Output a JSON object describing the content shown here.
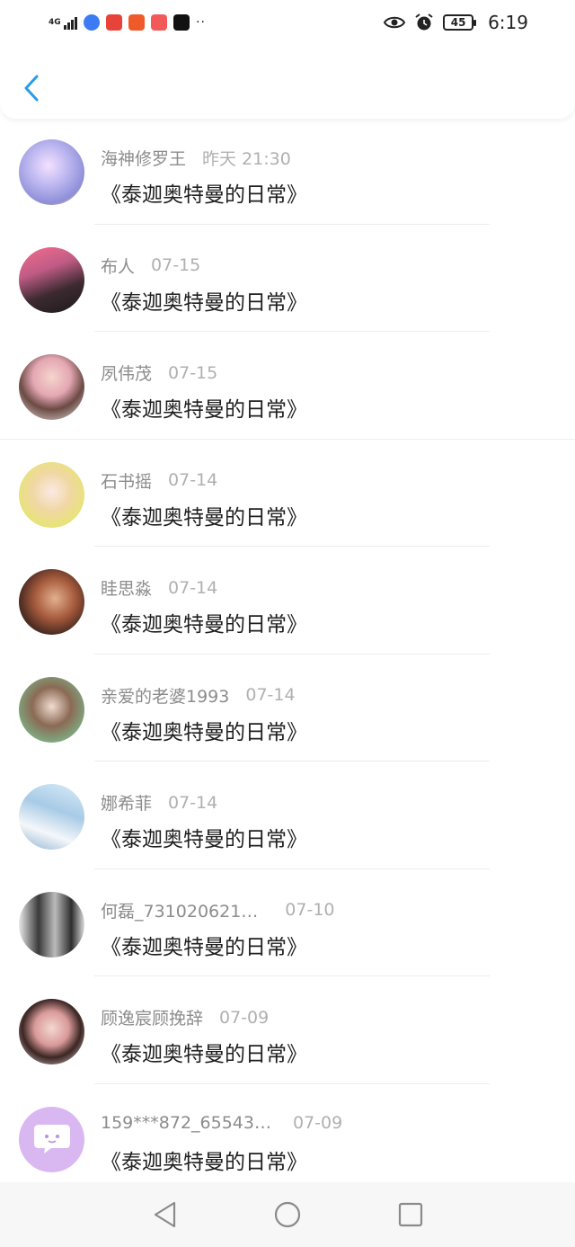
{
  "status_bar": {
    "network": "4G",
    "battery": "45",
    "time": "6:19"
  },
  "header": {
    "back_icon": "chevron-left-icon",
    "accent": "#2b9be8"
  },
  "rows": [
    {
      "name": "海神修罗王",
      "date": "昨天 21:30",
      "title": "《泰迦奥特曼的日常》"
    },
    {
      "name": "布人",
      "date": "07-15",
      "title": "《泰迦奥特曼的日常》"
    },
    {
      "name": "夙伟茂",
      "date": "07-15",
      "title": "《泰迦奥特曼的日常》"
    },
    {
      "name": "石书摇",
      "date": "07-14",
      "title": "《泰迦奥特曼的日常》"
    },
    {
      "name": "眭思淼",
      "date": "07-14",
      "title": "《泰迦奥特曼的日常》"
    },
    {
      "name": "亲爱的老婆1993",
      "date": "07-14",
      "title": "《泰迦奥特曼的日常》"
    },
    {
      "name": "娜希菲",
      "date": "07-14",
      "title": "《泰迦奥特曼的日常》"
    },
    {
      "name": "何磊_731020621…",
      "date": "07-10",
      "title": "《泰迦奥特曼的日常》"
    },
    {
      "name": "顾逸宸顾挽辞",
      "date": "07-09",
      "title": "《泰迦奥特曼的日常》"
    },
    {
      "name": "159***872_65543…",
      "date": "07-09",
      "title": "《泰迦奥特曼的日常》"
    }
  ],
  "bottom_nav": {
    "back_icon": "triangle-back-icon",
    "home_icon": "circle-home-icon",
    "recent_icon": "square-recents-icon"
  }
}
